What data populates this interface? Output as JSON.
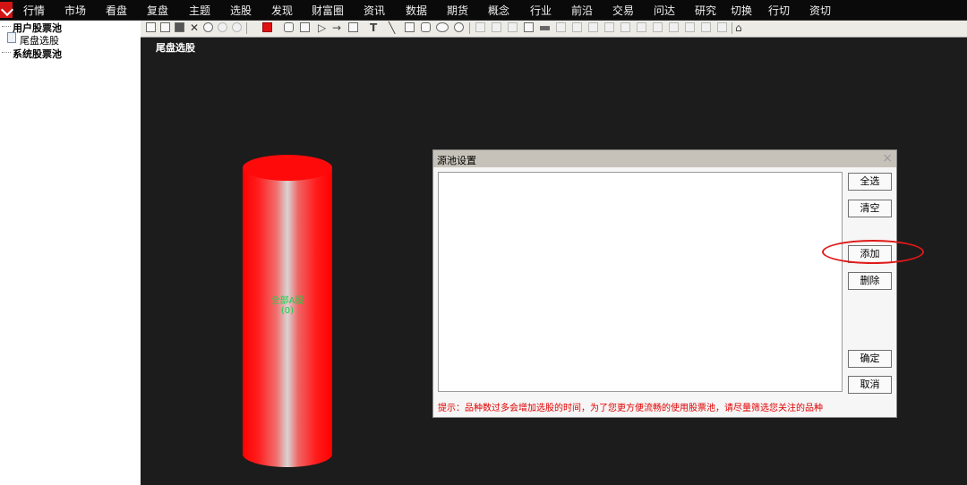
{
  "menu": {
    "items": [
      "行情",
      "市场",
      "看盘",
      "复盘",
      "主题",
      "选股",
      "发现",
      "财富圈",
      "资讯",
      "数据",
      "期货",
      "概念",
      "行业",
      "前沿",
      "交易",
      "问达",
      "研究",
      "切换",
      "行切",
      "资切"
    ]
  },
  "tree": {
    "user_pool": "用户股票池",
    "tail_pick": "尾盘选股",
    "system_pool": "系统股票池"
  },
  "canvas": {
    "title": "尾盘选股",
    "cylinder_line1": "全部A股",
    "cylinder_line2": "(0)"
  },
  "dialog": {
    "title": "源池设置",
    "close": "×",
    "select_all": "全选",
    "clear": "清空",
    "add": "添加",
    "delete": "删除",
    "ok": "确定",
    "cancel": "取消",
    "hint": "提示：品种数过多会增加选股的时间，为了您更方便流畅的使用股票池，请尽量筛选您关注的品种"
  },
  "colors": {
    "accent_red": "#e01010",
    "cylinder_label": "#19d24a",
    "hint_text": "#e00000"
  }
}
